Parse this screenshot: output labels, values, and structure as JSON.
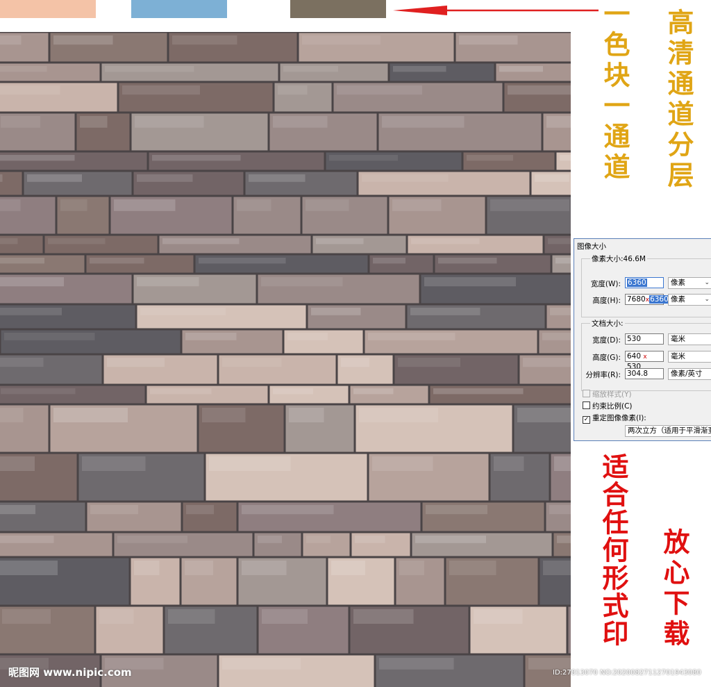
{
  "swatches": [
    {
      "name": "salmon",
      "color": "#f4c3a7"
    },
    {
      "name": "blue",
      "color": "#7db0d5"
    },
    {
      "name": "brown",
      "color": "#7b7060"
    }
  ],
  "arrow_color": "#e02020",
  "text_gold_1": "一色块一通道",
  "text_gold_2": "高清通道分层",
  "text_red_1": "适合任何形式印",
  "text_red_2": "放心下载",
  "dialog": {
    "title": "图像大小",
    "pixel_dimensions_label": "像素大小:46.6M",
    "width_label": "宽度(W):",
    "width_value": "6360",
    "width_unit": "像素",
    "height_label": "高度(H):",
    "height_value_prefix": "7680",
    "height_value_selected": "6360",
    "height_unit": "像素",
    "document_size_label": "文档大小:",
    "doc_width_label": "宽度(D):",
    "doc_width_value": "530",
    "doc_width_unit": "毫米",
    "doc_height_label": "高度(G):",
    "doc_height_value": "640",
    "doc_height_value_2": "530",
    "doc_height_unit": "毫米",
    "resolution_label": "分辨率(R):",
    "resolution_value": "304.8",
    "resolution_unit": "像素/英寸",
    "scale_styles_label": "缩放样式(Y)",
    "constrain_label": "约束比例(C)",
    "resample_label": "重定图像像素(I):",
    "resample_value": "两次立方（适用于平滑渐变"
  },
  "watermark_left": "昵图网 www.nipic.com",
  "watermark_right": "ID:27813070 NO:20200827112701943080"
}
